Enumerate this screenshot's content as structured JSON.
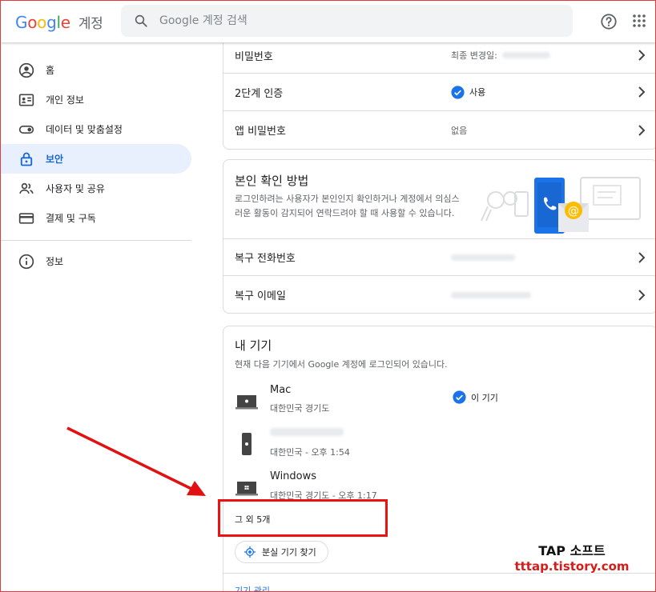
{
  "header": {
    "logo": "Google",
    "logo_suffix": "계정",
    "search_placeholder": "Google 계정 검색"
  },
  "sidebar": {
    "items": [
      {
        "label": "홈"
      },
      {
        "label": "개인 정보"
      },
      {
        "label": "데이터 및 맞춤설정"
      },
      {
        "label": "보안",
        "active": true
      },
      {
        "label": "사용자 및 공유"
      },
      {
        "label": "결제 및 구독"
      }
    ],
    "extra": [
      {
        "label": "정보"
      }
    ]
  },
  "signin": {
    "rows": [
      {
        "label": "비밀번호",
        "value": "최종 변경일:"
      },
      {
        "label": "2단계 인증",
        "value": "사용"
      },
      {
        "label": "앱 비밀번호",
        "value": "없음"
      }
    ]
  },
  "verify": {
    "title": "본인 확인 방법",
    "desc_line1": "로그인하려는 사용자가 본인인지 확인하거나 계정에서 의심스",
    "desc_line2": "러운 활동이 감지되어 연락드려야 할 때 사용할 수 있습니다.",
    "rows": [
      {
        "label": "복구 전화번호"
      },
      {
        "label": "복구 이메일"
      }
    ]
  },
  "devices": {
    "title": "내 기기",
    "desc": "현재 다음 기기에서 Google 계정에 로그인되어 있습니다.",
    "list": [
      {
        "name": "Mac",
        "location": "대한민국 경기도",
        "this_device": "이 기기"
      },
      {
        "name": "",
        "location": "대한민국 - 오후 1:54"
      },
      {
        "name": "Windows",
        "location": "대한민국 경기도 - 오후 1:17"
      }
    ],
    "more": "그 외 5개",
    "find_button": "분실 기기 찾기",
    "manage_link": "기기 관리"
  },
  "watermark": {
    "line1": "TAP 소프트",
    "line2": "tttap.tistory.com"
  },
  "colors": {
    "accent": "#1a73e8",
    "active_bg": "#e8f0fe",
    "annotation": "#e11111"
  }
}
